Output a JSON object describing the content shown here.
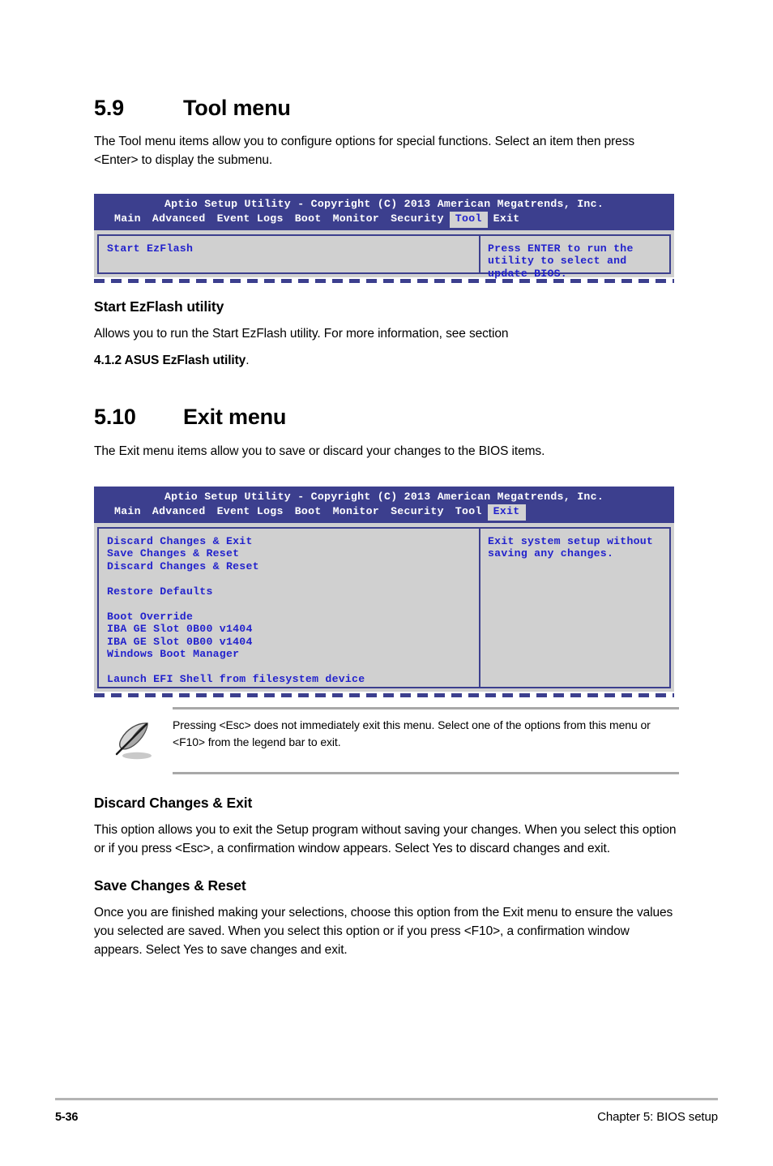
{
  "page": {
    "footer_page_number": "5-36",
    "footer_chapter": "Chapter 5: BIOS setup"
  },
  "section_tool": {
    "number": "5.9",
    "title": "Tool menu",
    "intro": "The Tool menu items allow you to configure options for special functions. Select an item then press <Enter> to display the submenu."
  },
  "bios_tool_screen": {
    "title": "Aptio Setup Utility - Copyright (C) 2013 American Megatrends, Inc.",
    "tabs": [
      {
        "label": "Main",
        "active": false
      },
      {
        "label": "Advanced",
        "active": false
      },
      {
        "label": "Event Logs",
        "active": false
      },
      {
        "label": "Boot",
        "active": false
      },
      {
        "label": "Monitor",
        "active": false
      },
      {
        "label": "Security",
        "active": false
      },
      {
        "label": "Tool",
        "active": true
      },
      {
        "label": "Exit",
        "active": false
      }
    ],
    "items": [
      "Start EzFlash"
    ],
    "help_lines": [
      "Press ENTER to run the",
      "utility to select and",
      "update BIOS."
    ]
  },
  "start_ezflash": {
    "heading": "Start EzFlash utility",
    "body_line1": "Allows you to run the Start EzFlash utility. For more information, see section",
    "body_bold": "4.1.2 ASUS EzFlash utility",
    "body_tail": "."
  },
  "section_exit": {
    "number": "5.10",
    "title": "Exit menu",
    "intro": "The Exit menu items allow you to save or discard your changes to the BIOS items."
  },
  "bios_exit_screen": {
    "title": "Aptio Setup Utility - Copyright (C) 2013 American Megatrends, Inc.",
    "tabs": [
      {
        "label": "Main",
        "active": false
      },
      {
        "label": "Advanced",
        "active": false
      },
      {
        "label": "Event Logs",
        "active": false
      },
      {
        "label": "Boot",
        "active": false
      },
      {
        "label": "Monitor",
        "active": false
      },
      {
        "label": "Security",
        "active": false
      },
      {
        "label": "Tool",
        "active": false
      },
      {
        "label": "Exit",
        "active": true
      }
    ],
    "items": [
      "Discard Changes & Exit",
      "Save Changes & Reset",
      "Discard Changes & Reset",
      "",
      "Restore Defaults",
      "",
      "Boot Override",
      "IBA GE Slot 0B00 v1404",
      "IBA GE Slot 0B00 v1404",
      "Windows Boot Manager",
      "",
      "Launch EFI Shell from filesystem device"
    ],
    "help_lines": [
      "Exit system setup without",
      "saving any changes."
    ]
  },
  "note": {
    "icon": "quill-pen-icon",
    "text": "Pressing <Esc> does not immediately exit this menu. Select one of the options from this menu or <F10> from the legend bar to exit."
  },
  "discard_changes_exit": {
    "heading": "Discard Changes & Exit",
    "body": "This option allows you to exit the Setup program without saving your changes. When you select this option or if you press <Esc>, a confirmation window appears. Select Yes to discard changes and exit."
  },
  "save_changes_reset": {
    "heading": "Save Changes & Reset",
    "body": "Once you are finished making your selections, choose this option from the Exit menu to ensure the values you selected are saved. When you select this option or if you press <F10>, a confirmation window appears. Select Yes to save changes and exit."
  },
  "colors": {
    "bios_header_bg": "#3c3f8e",
    "bios_body_bg": "#d0d0d0",
    "bios_text": "#2222cc",
    "bios_title_text": "#ffffff",
    "active_tab_bg": "#d2d2d2",
    "rule_gray": "#a8a8a8"
  }
}
